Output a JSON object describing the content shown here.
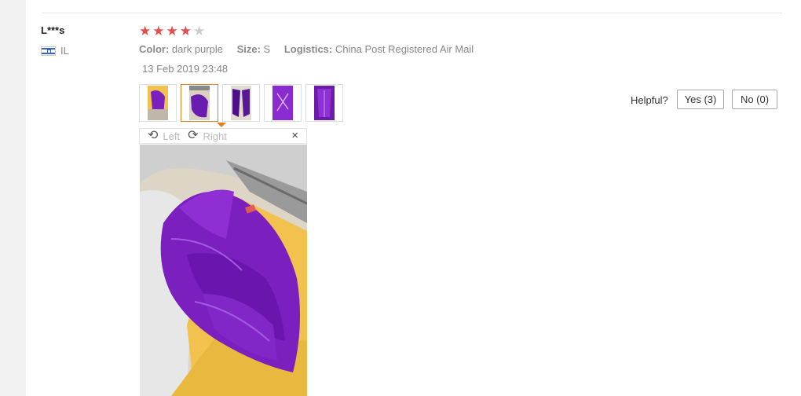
{
  "review": {
    "user": "L***s",
    "country_code": "IL",
    "rating": 4,
    "rating_max": 5,
    "color_label": "Color:",
    "color_value": "dark purple",
    "size_label": "Size:",
    "size_value": "S",
    "logistics_label": "Logistics:",
    "logistics_value": "China Post Registered Air Mail",
    "date": "13 Feb 2019 23:48",
    "photo_count": 5,
    "selected_photo": 2
  },
  "viewer": {
    "rotate_left_label": "Left",
    "rotate_right_label": "Right",
    "close_glyph": "×"
  },
  "helpful": {
    "label": "Helpful?",
    "yes_label": "Yes (3)",
    "no_label": "No (0)"
  },
  "colors": {
    "star_active": "#e74c4c",
    "accent": "#e67e22",
    "feather": "#7b1fbf"
  },
  "icons": {
    "rotate_left": "rotate-left-icon",
    "rotate_right": "rotate-right-icon",
    "close": "close-icon",
    "flag": "flag-israel-icon"
  }
}
